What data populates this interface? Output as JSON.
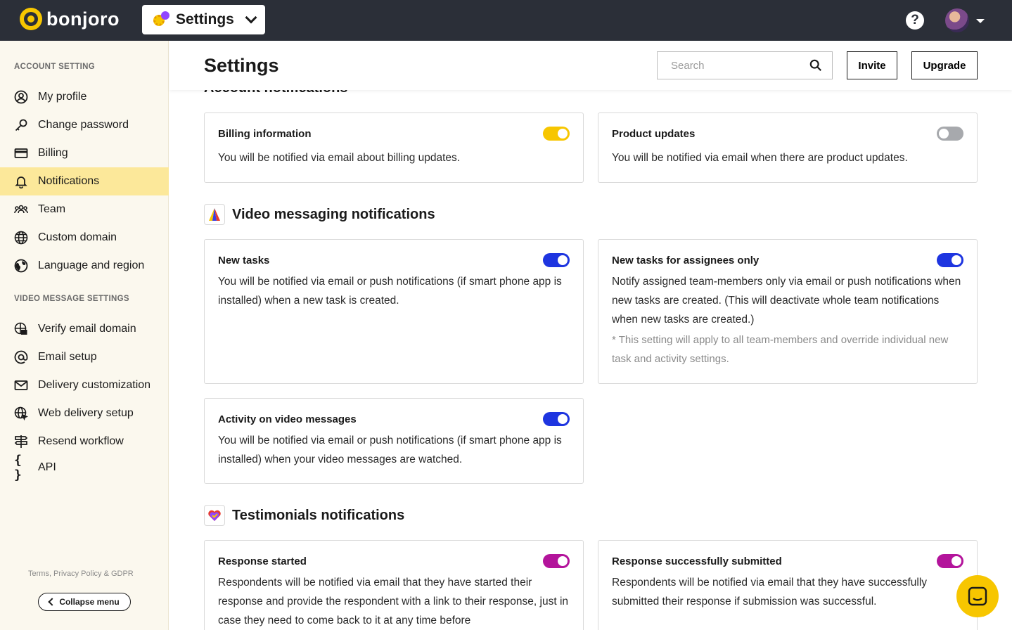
{
  "brand": {
    "name": "bonjoro",
    "accent": "#f7c600",
    "topbar_bg": "#2b2f38"
  },
  "app_switcher": {
    "label": "Settings"
  },
  "topbar": {
    "help_label": "?"
  },
  "sidebar": {
    "sections": [
      {
        "title": "ACCOUNT SETTING",
        "items": [
          {
            "label": "My profile",
            "icon": "user-circle-icon"
          },
          {
            "label": "Change password",
            "icon": "key-icon"
          },
          {
            "label": "Billing",
            "icon": "credit-card-icon"
          },
          {
            "label": "Notifications",
            "icon": "bell-icon",
            "active": true
          },
          {
            "label": "Team",
            "icon": "team-icon"
          },
          {
            "label": "Custom domain",
            "icon": "globe-icon"
          },
          {
            "label": "Language and region",
            "icon": "earth-icon"
          }
        ]
      },
      {
        "title": "VIDEO MESSAGE SETTINGS",
        "items": [
          {
            "label": "Verify email domain",
            "icon": "verify-domain-icon"
          },
          {
            "label": "Email setup",
            "icon": "at-icon"
          },
          {
            "label": "Delivery customization",
            "icon": "envelope-icon"
          },
          {
            "label": "Web delivery setup",
            "icon": "web-globe-icon"
          },
          {
            "label": "Resend workflow",
            "icon": "signpost-icon"
          },
          {
            "label": "API",
            "icon": "braces-icon"
          }
        ]
      }
    ],
    "footer_text": "Terms, Privacy Policy & GDPR",
    "collapse_label": "Collapse menu"
  },
  "header": {
    "title": "Settings",
    "search_placeholder": "Search",
    "invite_label": "Invite",
    "upgrade_label": "Upgrade"
  },
  "sections": {
    "account": {
      "heading": "Account notifications",
      "cards": [
        {
          "title": "Billing information",
          "desc": "You will be notified via email about billing updates.",
          "on": true,
          "color": "#f7c600"
        },
        {
          "title": "Product updates",
          "desc": "You will be notified via email when there are product updates.",
          "on": false,
          "color": "#a7a9ad"
        }
      ]
    },
    "video": {
      "heading": "Video messaging notifications",
      "cards": [
        {
          "title": "New tasks",
          "desc": "You will be notified via email or push notifications (if smart phone app is installed) when a new task is created.",
          "on": true,
          "color": "#1e35e0"
        },
        {
          "title": "New tasks for assignees only",
          "desc": "Notify assigned team-members only via email or push notifications when new tasks are created. (This will deactivate whole team notifications when new tasks are created.)",
          "note": "* This setting will apply to all team-members and override individual new task and activity settings.",
          "on": true,
          "color": "#1e35e0"
        },
        {
          "title": "Activity on video messages",
          "desc": "You will be notified via email or push notifications (if smart phone app is installed) when your video messages are watched.",
          "on": true,
          "color": "#1e35e0"
        }
      ]
    },
    "testimonials": {
      "heading": "Testimonials notifications",
      "cards": [
        {
          "title": "Response started",
          "desc": "Respondents will be notified via email that they have started their response and provide the respondent with a link to their response, just in case they need to come back to it at any time before",
          "on": true,
          "color": "#b3149b"
        },
        {
          "title": "Response successfully submitted",
          "desc": "Respondents will be notified via email that they have successfully submitted their response if submission was successful.",
          "on": true,
          "color": "#b3149b"
        }
      ]
    }
  }
}
